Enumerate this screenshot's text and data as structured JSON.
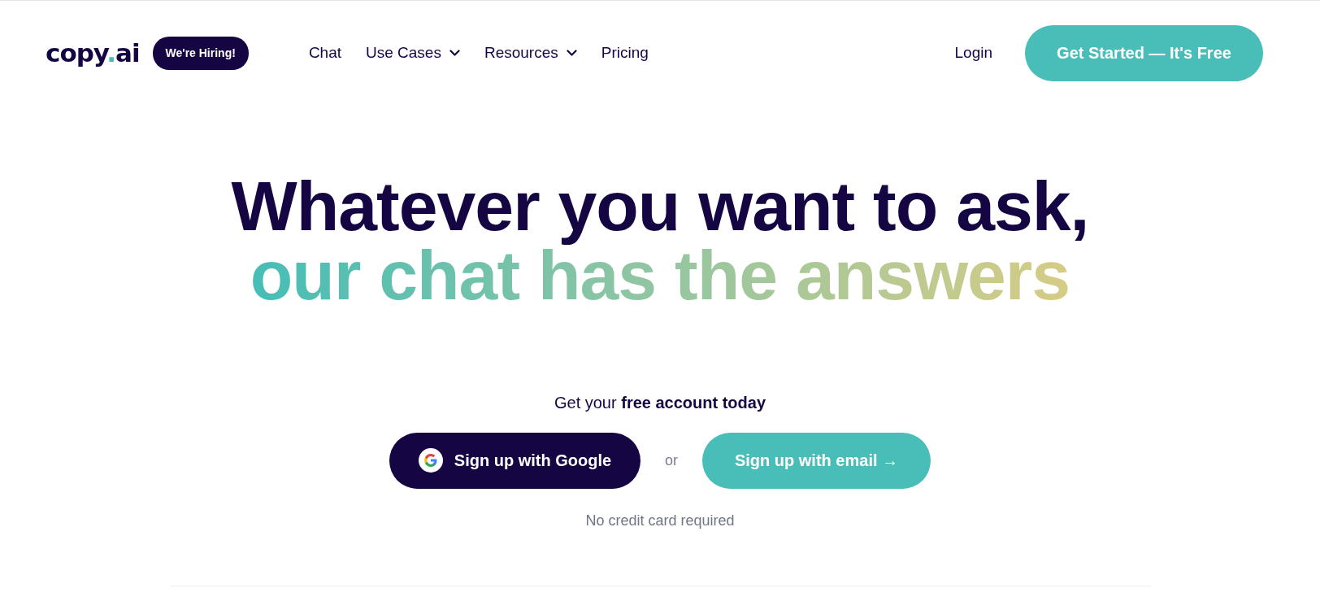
{
  "logo": {
    "before": "copy",
    "dot": ".",
    "after": "ai"
  },
  "hiring_badge": "We're Hiring!",
  "nav": [
    {
      "label": "Chat",
      "has_menu": false
    },
    {
      "label": "Use Cases",
      "has_menu": true
    },
    {
      "label": "Resources",
      "has_menu": true
    },
    {
      "label": "Pricing",
      "has_menu": false
    }
  ],
  "login": "Login",
  "cta": "Get Started — It's Free",
  "headline": {
    "line1": "Whatever you want to ask,",
    "line2": "our chat has the answers"
  },
  "signup": {
    "prompt": "Get your **free account today**",
    "google_button": "Sign up with Google",
    "or": "or",
    "email_button": "Sign up with email",
    "email_arrow": "→",
    "note": "No credit card required"
  }
}
